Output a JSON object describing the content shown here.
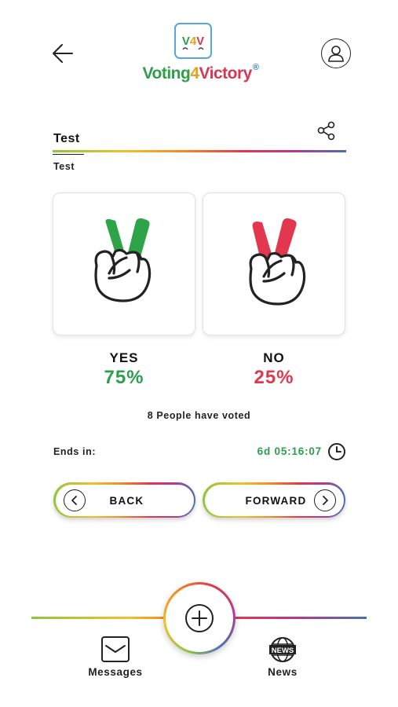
{
  "header": {
    "logo_mark": "V4V",
    "brand": {
      "part1": "Voting",
      "part2": "4",
      "part3": "Victory",
      "reg": "®"
    }
  },
  "poll": {
    "title": "Test",
    "description": "Test",
    "options": [
      {
        "label": "YES",
        "percent": "75%",
        "color": "#2c9e4e"
      },
      {
        "label": "NO",
        "percent": "25%",
        "color": "#e0384f"
      }
    ],
    "voters_text": "8 People have voted",
    "ends_label": "Ends in:",
    "countdown": "6d 05:16:07"
  },
  "navigation": {
    "back_label": "BACK",
    "forward_label": "FORWARD"
  },
  "bottom_nav": {
    "messages_label": "Messages",
    "news_label": "News",
    "news_icon_text": "NEWS"
  },
  "icons": [
    "arrow-left-icon",
    "logo-icon",
    "user-profile-icon",
    "share-icon",
    "peace-hand-yes-icon",
    "peace-hand-no-icon",
    "clock-icon",
    "chevron-left-icon",
    "chevron-right-icon",
    "plus-icon",
    "envelope-icon",
    "globe-news-icon"
  ],
  "colors": {
    "yes": "#2c9e4e",
    "no": "#e0384f",
    "gradient": [
      "#8dc63f",
      "#f2c029",
      "#f08a24",
      "#e2374d",
      "#b43a8f",
      "#4a6fb5"
    ]
  }
}
